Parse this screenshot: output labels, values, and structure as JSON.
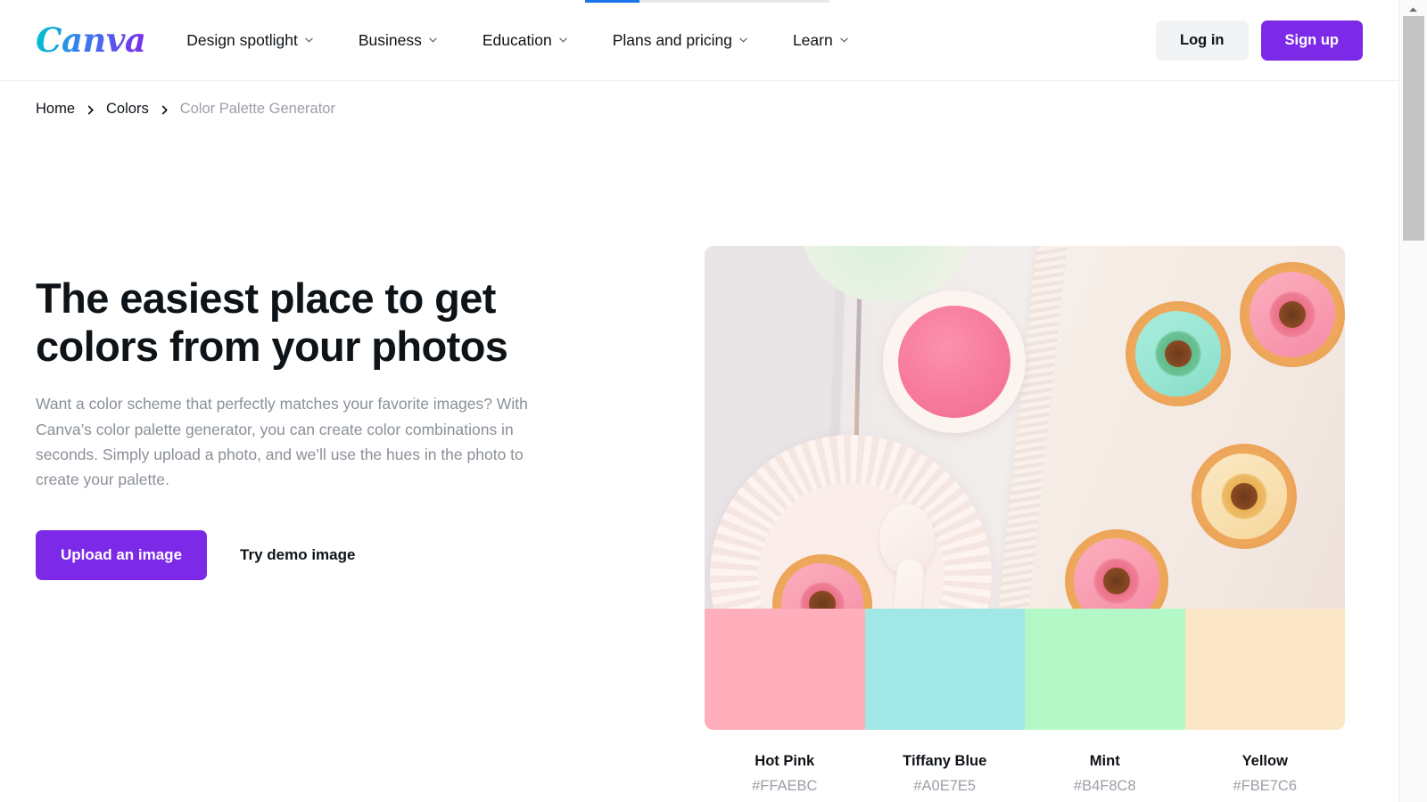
{
  "loading_bar": {
    "progress_label": "22%"
  },
  "header": {
    "logo_text": "Canva",
    "logo_gradient_from": "#00C4CC",
    "logo_gradient_to": "#7D2AE8",
    "nav_items": [
      {
        "label": "Design spotlight",
        "icon": "chevron-down-icon"
      },
      {
        "label": "Business",
        "icon": "chevron-down-icon"
      },
      {
        "label": "Education",
        "icon": "chevron-down-icon"
      },
      {
        "label": "Plans and pricing",
        "icon": "chevron-down-icon"
      },
      {
        "label": "Learn",
        "icon": "chevron-down-icon"
      }
    ],
    "login_label": "Log in",
    "signup_label": "Sign up",
    "signup_color": "#7D2AE8"
  },
  "breadcrumb": {
    "items": [
      {
        "label": "Home",
        "current": false
      },
      {
        "label": "Colors",
        "current": false
      },
      {
        "label": "Color Palette Generator",
        "current": true
      }
    ]
  },
  "hero": {
    "title": "The easiest place to get colors from your photos",
    "description": "Want a color scheme that perfectly matches your favorite images? With Canva’s color palette generator, you can create color combinations in seconds. Simply upload a photo, and we’ll use the hues in the photo to create your palette.",
    "primary_cta": "Upload an image",
    "secondary_cta": "Try demo image"
  },
  "preview": {
    "photo_alt": "Overhead photo of pastel-glazed mini donuts on a ceramic tray with a bowl of pink icing",
    "palette": [
      {
        "name": "Hot Pink",
        "hex": "#FFAEBC"
      },
      {
        "name": "Tiffany Blue",
        "hex": "#A0E7E5"
      },
      {
        "name": "Mint",
        "hex": "#B4F8C8"
      },
      {
        "name": "Yellow",
        "hex": "#FBE7C6"
      }
    ]
  },
  "scrollbar": {
    "position_label": "top"
  }
}
